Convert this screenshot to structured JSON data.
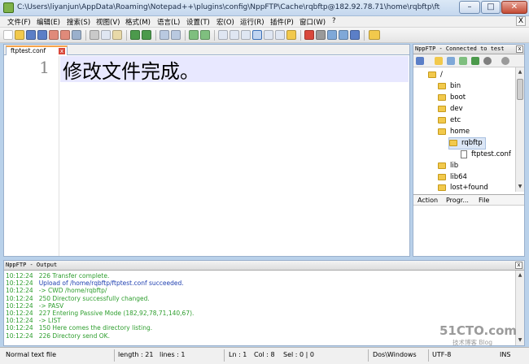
{
  "window": {
    "title": "C:\\Users\\liyanjun\\AppData\\Roaming\\Notepad++\\plugins\\config\\NppFTP\\Cache\\rqbftp@182.92.78.71\\home\\rqbftp\\ftptest.conf - Notepad++",
    "controls": {
      "minimize": "–",
      "maximize": "□",
      "close": "✕"
    }
  },
  "menu": [
    "文件(F)",
    "编辑(E)",
    "搜索(S)",
    "视图(V)",
    "格式(M)",
    "语言(L)",
    "设置(T)",
    "宏(O)",
    "运行(R)",
    "插件(P)",
    "窗口(W)",
    "?"
  ],
  "menu_close": "X",
  "editor": {
    "tab_label": "ftptest.conf",
    "tab_close": "x",
    "line_number": "1",
    "text": "修改文件完成。"
  },
  "ftp_panel": {
    "title": "NppFTP - Connected to test",
    "close": "x",
    "tree": [
      {
        "label": "/",
        "type": "folder"
      },
      {
        "label": "bin",
        "type": "folder"
      },
      {
        "label": "boot",
        "type": "folder"
      },
      {
        "label": "dev",
        "type": "folder"
      },
      {
        "label": "etc",
        "type": "folder"
      },
      {
        "label": "home",
        "type": "folder"
      },
      {
        "label": "rqbftp",
        "type": "folder",
        "selected": true
      },
      {
        "label": "ftptest.conf",
        "type": "file"
      },
      {
        "label": "lib",
        "type": "folder"
      },
      {
        "label": "lib64",
        "type": "folder"
      },
      {
        "label": "lost+found",
        "type": "folder"
      }
    ],
    "queue_columns": [
      "Action",
      "Progr...",
      "File"
    ]
  },
  "output": {
    "title": "NppFTP - Output",
    "close": "x",
    "lines": [
      {
        "time": "10:12:24",
        "text": "226 Transfer complete.",
        "color": "#2e9e2e"
      },
      {
        "time": "10:12:24",
        "text": "Upload of /home/rqbftp/ftptest.conf succeeded.",
        "color": "#1f3fb0"
      },
      {
        "time": "10:12:24",
        "text": "-> CWD /home/rqbftp/",
        "color": "#2e9e2e"
      },
      {
        "time": "10:12:24",
        "text": "250 Directory successfully changed.",
        "color": "#2e9e2e"
      },
      {
        "time": "10:12:24",
        "text": "-> PASV",
        "color": "#2e9e2e"
      },
      {
        "time": "10:12:24",
        "text": "227 Entering Passive Mode (182,92,78,71,140,67).",
        "color": "#2e9e2e"
      },
      {
        "time": "10:12:24",
        "text": "-> LIST",
        "color": "#2e9e2e"
      },
      {
        "time": "10:12:24",
        "text": "150 Here comes the directory listing.",
        "color": "#2e9e2e"
      },
      {
        "time": "10:12:24",
        "text": "226 Directory send OK.",
        "color": "#2e9e2e"
      }
    ]
  },
  "status": {
    "type": "Normal text file",
    "length": "length : 21",
    "lines": "lines : 1",
    "ln": "Ln : 1",
    "col": "Col : 8",
    "sel": "Sel : 0 | 0",
    "eol": "Dos\\Windows",
    "encoding": "UTF-8",
    "mode": "INS"
  },
  "watermark": {
    "main": "51CTO.com",
    "sub": "技术博客 Blog"
  },
  "colors": {
    "accent_tab": "#f7a44b",
    "line_highlight": "#e8e8ff",
    "log_green": "#2e9e2e",
    "log_blue": "#1f3fb0"
  }
}
